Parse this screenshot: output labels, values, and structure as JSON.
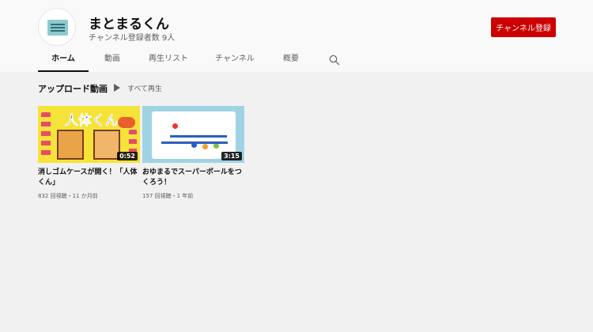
{
  "channel": {
    "name": "まとまるくん",
    "subscribers": "チャンネル登録者数 9人",
    "subscribe_label": "チャンネル登録"
  },
  "icons": {
    "avatar": "channel-logo",
    "search": "search-icon",
    "play": "play-icon"
  },
  "tabs": [
    {
      "label": "ホーム",
      "active": true
    },
    {
      "label": "動画"
    },
    {
      "label": "再生リスト"
    },
    {
      "label": "チャンネル"
    },
    {
      "label": "概要"
    }
  ],
  "section": {
    "title": "アップロード動画",
    "play_all_label": "すべて再生"
  },
  "videos": [
    {
      "title": "消しゴムケースが開く！「人体くん」",
      "meta": "832 回視聴・11 か月前",
      "duration": "0:52"
    },
    {
      "title": "おゆまるでスーパーボールをつくろう！",
      "meta": "157 回視聴・1 年前",
      "duration": "3:15"
    }
  ],
  "colors": {
    "accent": "#cc0000",
    "background": "#f1f1f1",
    "header": "#f9f9f9"
  }
}
